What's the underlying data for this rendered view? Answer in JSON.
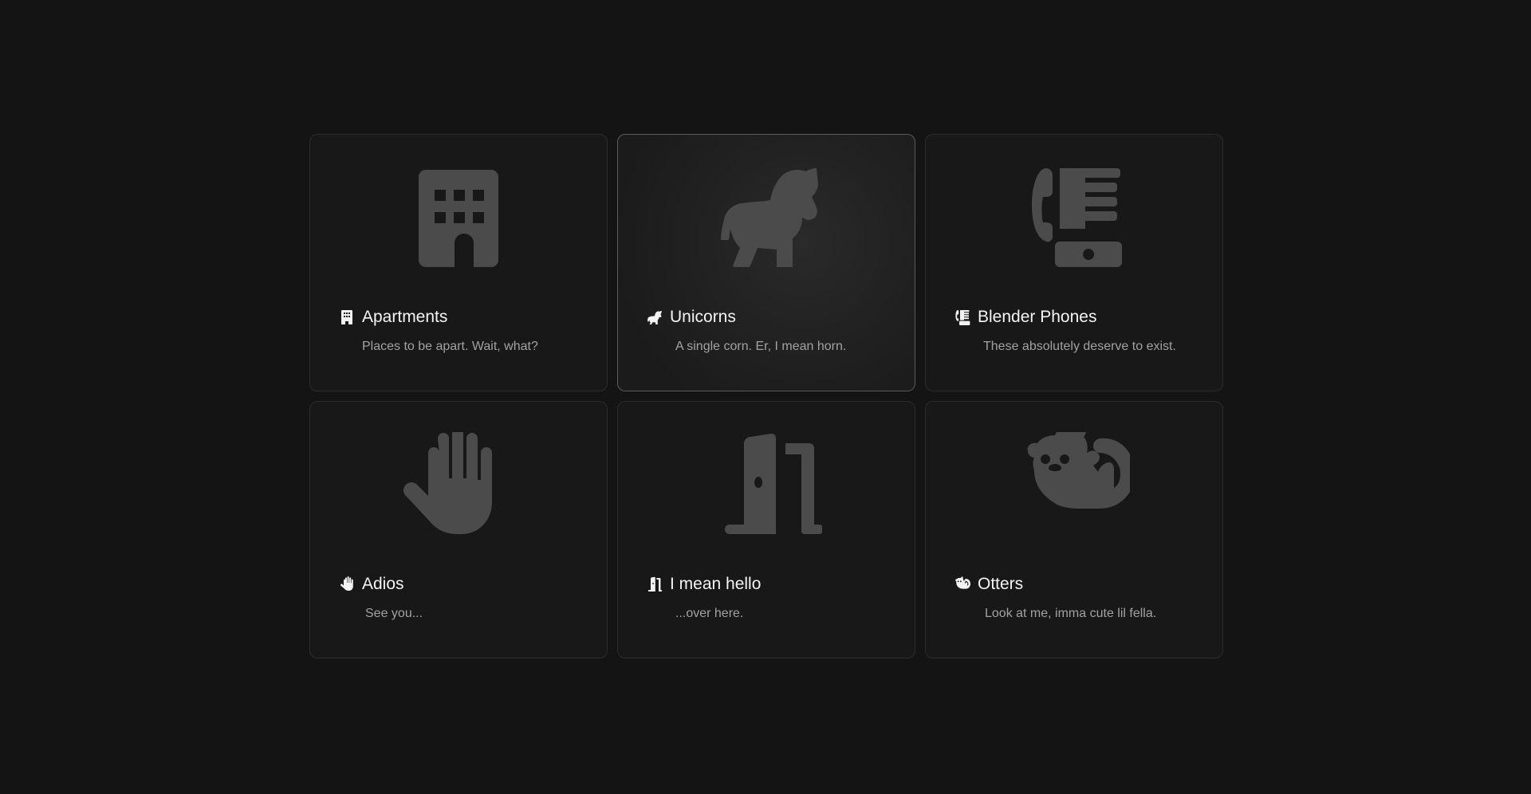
{
  "colors": {
    "background": "#141414",
    "card_background": "#181818",
    "card_border": "#2c2c2c",
    "icon_fill": "#4b4b4b",
    "title_text": "#f4f4f4",
    "description_text": "#a2a2a2"
  },
  "cards": [
    {
      "icon": "building-icon",
      "title": "Apartments",
      "description": "Places to be apart. Wait, what?"
    },
    {
      "icon": "horse-icon",
      "title": "Unicorns",
      "description": "A single corn. Er, I mean horn."
    },
    {
      "icon": "blender-phone-icon",
      "title": "Blender Phones",
      "description": "These absolutely deserve to exist."
    },
    {
      "icon": "hand-icon",
      "title": "Adios",
      "description": "See you..."
    },
    {
      "icon": "door-open-icon",
      "title": "I mean hello",
      "description": "...over here."
    },
    {
      "icon": "otter-icon",
      "title": "Otters",
      "description": "Look at me, imma cute lil fella."
    }
  ]
}
